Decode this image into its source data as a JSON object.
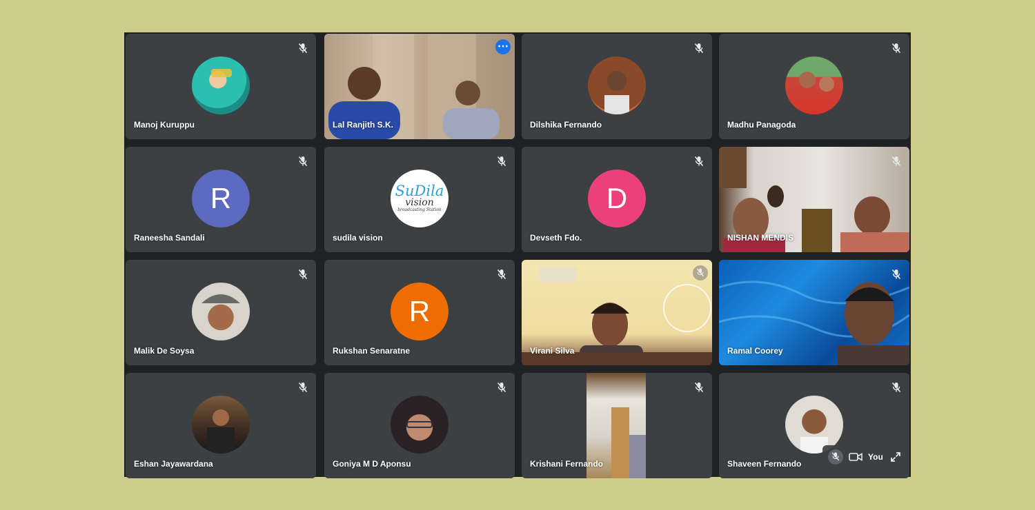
{
  "participants": [
    {
      "name": "Manoj Kuruppu",
      "type": "photo",
      "avatar_color": "#2bbfb0"
    },
    {
      "name": "Lal Ranjith S.K.",
      "type": "video",
      "active": true
    },
    {
      "name": "Dilshika Fernando",
      "type": "photo",
      "avatar_color": "#8a4a2a"
    },
    {
      "name": "Madhu Panagoda",
      "type": "photo",
      "avatar_color": "#c7473a"
    },
    {
      "name": "Raneesha Sandali",
      "type": "letter",
      "initial": "R",
      "avatar_color": "#5c6bc0"
    },
    {
      "name": "sudila vision",
      "type": "logo",
      "avatar_color": "#ffffff"
    },
    {
      "name": "Devseth Fdo.",
      "type": "letter",
      "initial": "D",
      "avatar_color": "#ec407a"
    },
    {
      "name": "NISHAN MENDIS",
      "type": "video"
    },
    {
      "name": "Malik De Soysa",
      "type": "photo",
      "avatar_color": "#b8b2a8"
    },
    {
      "name": "Rukshan Senaratne",
      "type": "letter",
      "initial": "R",
      "avatar_color": "#ef6c00"
    },
    {
      "name": "Virani Silva",
      "type": "video"
    },
    {
      "name": "Ramal Coorey",
      "type": "video"
    },
    {
      "name": "Eshan Jayawardana",
      "type": "photo",
      "avatar_color": "#3b2a20"
    },
    {
      "name": "Goniya M D Aponsu",
      "type": "photo",
      "avatar_color": "#5a4a48"
    },
    {
      "name": "Krishani Fernando",
      "type": "video"
    },
    {
      "name": "Shaveen Fernando",
      "type": "photo",
      "avatar_color": "#d8d2c8"
    }
  ],
  "logo_text": {
    "line1": "SuDila",
    "line2": "vision",
    "line3": "broadcasting Station"
  },
  "self_view": {
    "label": "You"
  },
  "icons": {
    "mic_off": "mic-off-icon",
    "more": "more-options-icon",
    "camera": "camera-icon",
    "expand": "expand-icon"
  },
  "colors": {
    "background": "#cfcd8c",
    "meet_bg": "#202124",
    "tile_bg": "#3c4043",
    "active_outline": "#8ab4f8",
    "accent_blue": "#1a73e8"
  }
}
